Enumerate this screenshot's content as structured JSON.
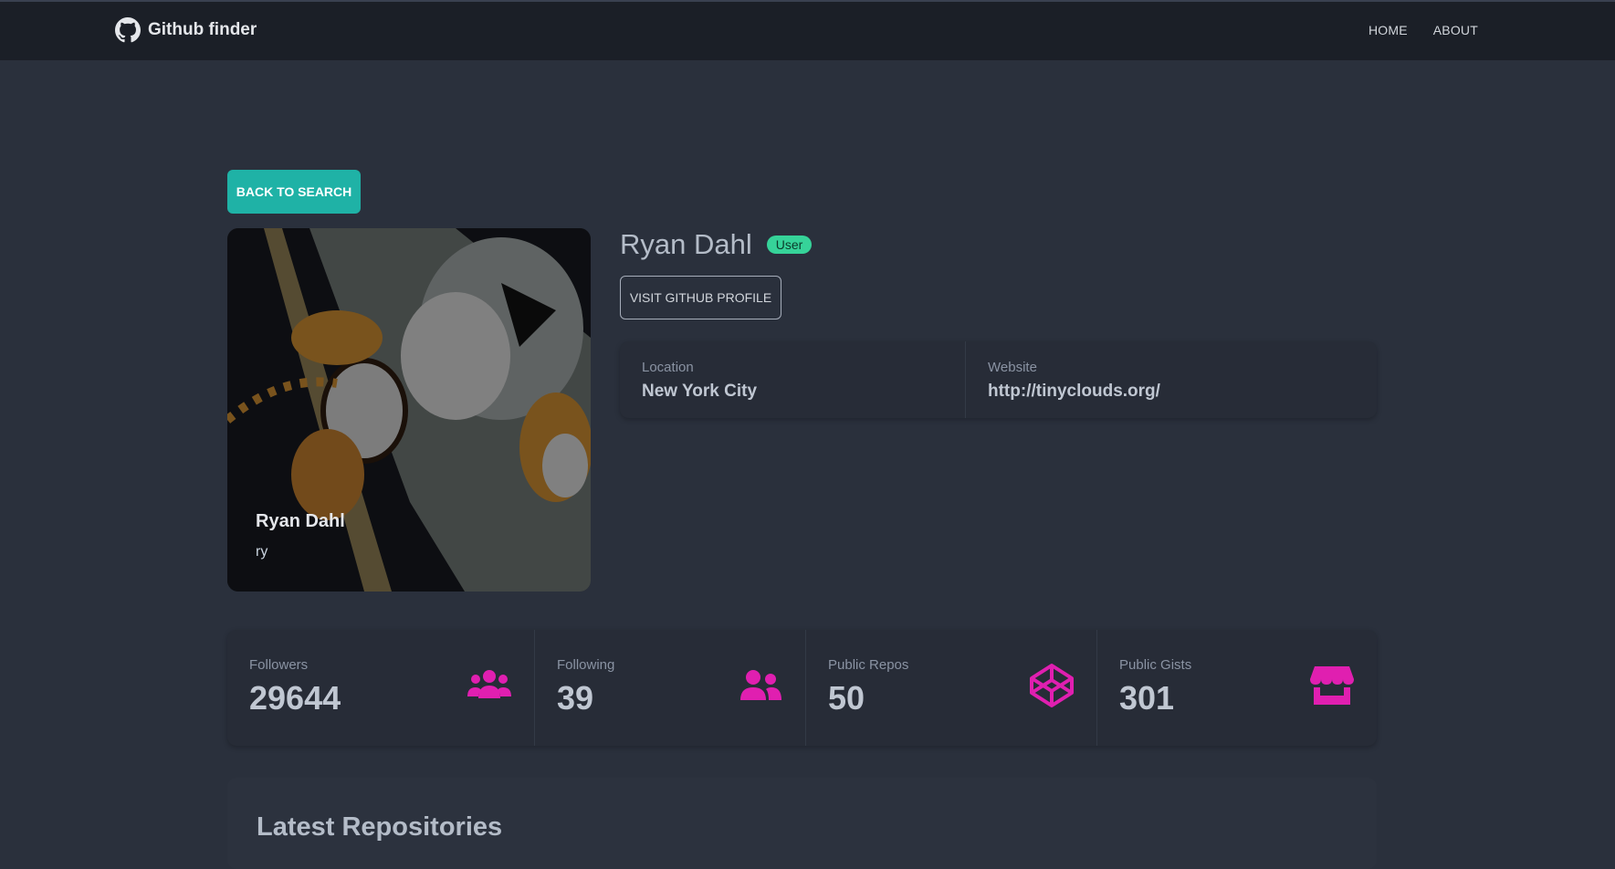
{
  "navbar": {
    "brand": "Github finder",
    "links": [
      "HOME",
      "ABOUT"
    ]
  },
  "back_button": "BACK TO SEARCH",
  "profile": {
    "name": "Ryan Dahl",
    "login": "ry",
    "badge": "User",
    "visit_button": "VISIT GITHUB PROFILE",
    "location_label": "Location",
    "location_value": "New York City",
    "website_label": "Website",
    "website_value": "http://tinyclouds.org/"
  },
  "stats": [
    {
      "label": "Followers",
      "value": "29644",
      "icon": "users-icon"
    },
    {
      "label": "Following",
      "value": "39",
      "icon": "user-friends-icon"
    },
    {
      "label": "Public Repos",
      "value": "50",
      "icon": "codepen-icon"
    },
    {
      "label": "Public Gists",
      "value": "301",
      "icon": "store-icon"
    }
  ],
  "repos": {
    "title": "Latest Repositories"
  },
  "colors": {
    "accent": "#1fb2a6",
    "icon": "#e01fb0",
    "badge": "#36d399",
    "bg": "#2a303c",
    "navbar": "#1b1f27"
  }
}
